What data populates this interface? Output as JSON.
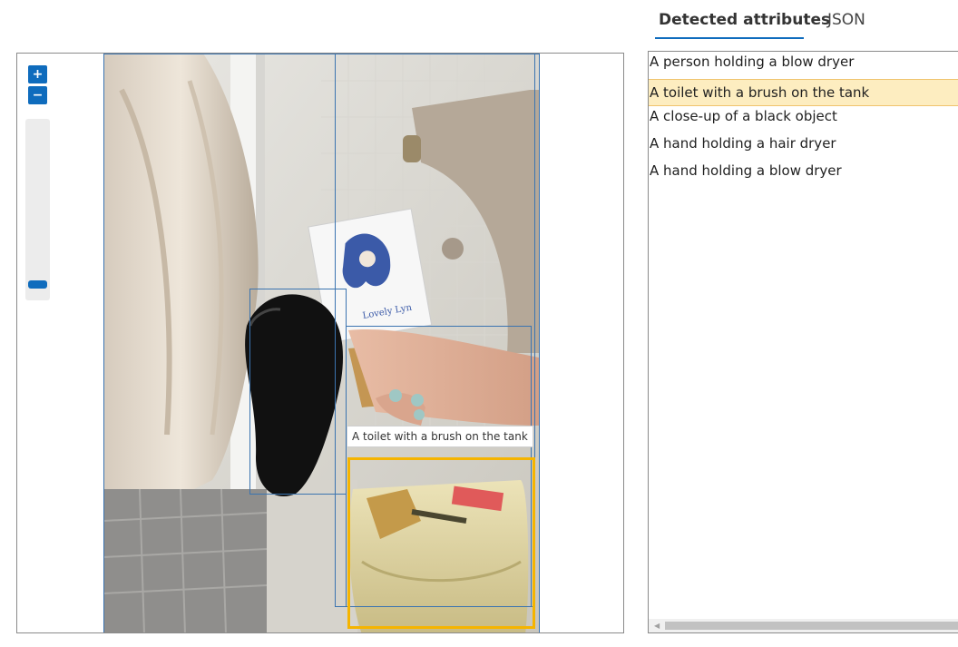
{
  "tabs": {
    "detected": "Detected attributes",
    "json": "JSON"
  },
  "zoom": {
    "zoom_in": "+",
    "zoom_out": "−",
    "level": 0.0
  },
  "tooltip": "A toilet with a brush on the tank",
  "attributes": [
    {
      "label": "A person holding a blow dryer",
      "selected": false
    },
    {
      "label": "A toilet with a brush on the tank",
      "selected": true
    },
    {
      "label": "A close-up of a black object",
      "selected": false
    },
    {
      "label": "A hand holding a hair dryer",
      "selected": false
    },
    {
      "label": "A hand holding a blow dryer",
      "selected": false
    }
  ],
  "colors": {
    "accent": "#0f6cbd",
    "box": "#3b74b0",
    "selected_box": "#f5b400",
    "selected_row": "#fdedc0"
  }
}
